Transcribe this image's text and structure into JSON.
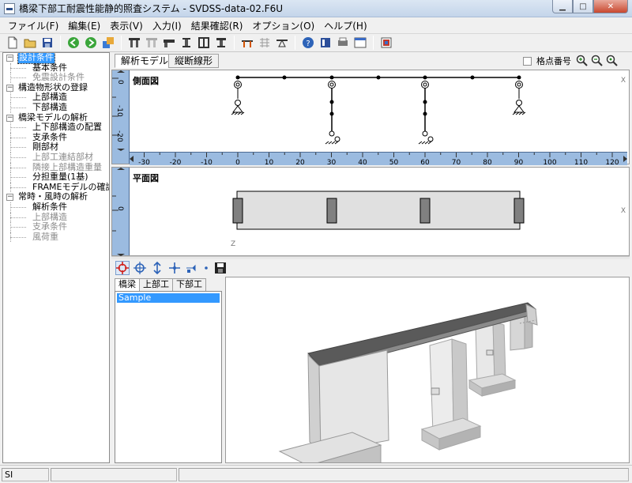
{
  "window": {
    "title": "橋梁下部工耐震性能静的照査システム - SVDSS-data-02.F6U",
    "minimize": "▁",
    "maximize": "□",
    "close": "✕"
  },
  "menu": [
    "ファイル(F)",
    "編集(E)",
    "表示(V)",
    "入力(I)",
    "結果確認(R)",
    "オプション(O)",
    "ヘルプ(H)"
  ],
  "toolbar": {
    "icons": [
      "new-file-icon",
      "open-folder-icon",
      "save-icon",
      "sep",
      "back-icon",
      "forward-icon",
      "export-icon",
      "sep",
      "pier-icon",
      "pier-alt-icon",
      "abutment-icon",
      "column-icon",
      "frame-icon",
      "truss-icon",
      "sep",
      "bridge-3d-icon",
      "grid-icon",
      "support-icon",
      "sep",
      "help-icon",
      "book-icon",
      "print-icon",
      "window-icon",
      "sep",
      "settings-icon"
    ]
  },
  "tree": [
    {
      "label": "設計条件",
      "level": 0,
      "expander": "−",
      "selected": true
    },
    {
      "label": "基本条件",
      "level": 1
    },
    {
      "label": "免震設計条件",
      "level": 1,
      "disabled": true
    },
    {
      "label": "構造物形状の登録",
      "level": 0,
      "expander": "−"
    },
    {
      "label": "上部構造",
      "level": 1
    },
    {
      "label": "下部構造",
      "level": 1
    },
    {
      "label": "橋梁モデルの解析",
      "level": 0,
      "expander": "−"
    },
    {
      "label": "上下部構造の配置",
      "level": 1
    },
    {
      "label": "支承条件",
      "level": 1
    },
    {
      "label": "剛部材",
      "level": 1
    },
    {
      "label": "上部工連結部材",
      "level": 1,
      "disabled": true
    },
    {
      "label": "隣接上部構造重量",
      "level": 1,
      "disabled": true
    },
    {
      "label": "分担重量(1基)",
      "level": 1
    },
    {
      "label": "FRAMEモデルの確認",
      "level": 1
    },
    {
      "label": "常時・風時の解析",
      "level": 0,
      "expander": "−"
    },
    {
      "label": "解析条件",
      "level": 1
    },
    {
      "label": "上部構造",
      "level": 1,
      "disabled": true
    },
    {
      "label": "支承条件",
      "level": 1,
      "disabled": true
    },
    {
      "label": "風荷重",
      "level": 1,
      "disabled": true
    }
  ],
  "view_tabs": {
    "analysis_model": "解析モデル",
    "longitudinal": "縦断線形"
  },
  "node_number_label": "格点番号",
  "side_view": {
    "label": "側面図",
    "axis_x_ticks": [
      "-30",
      "-20",
      "-10",
      "0",
      "10",
      "20",
      "30",
      "40",
      "50",
      "60",
      "70",
      "80",
      "90",
      "100",
      "110",
      "120"
    ],
    "axis_y_ticks": [
      "0",
      "-10",
      "-20"
    ],
    "corner_x": "X"
  },
  "plan_view": {
    "label": "平面図",
    "axis_y_ticks": [
      "0"
    ],
    "corner_x": "X",
    "corner_z": "Z"
  },
  "bottom_tabs": [
    "橋梁",
    "上部工",
    "下部工"
  ],
  "list_items": [
    "Sample"
  ],
  "status": {
    "unit": "SI"
  },
  "colors": {
    "ruler": "#9bbbe0",
    "selection": "#3399ff",
    "title_bar": "#c4d5ea"
  }
}
